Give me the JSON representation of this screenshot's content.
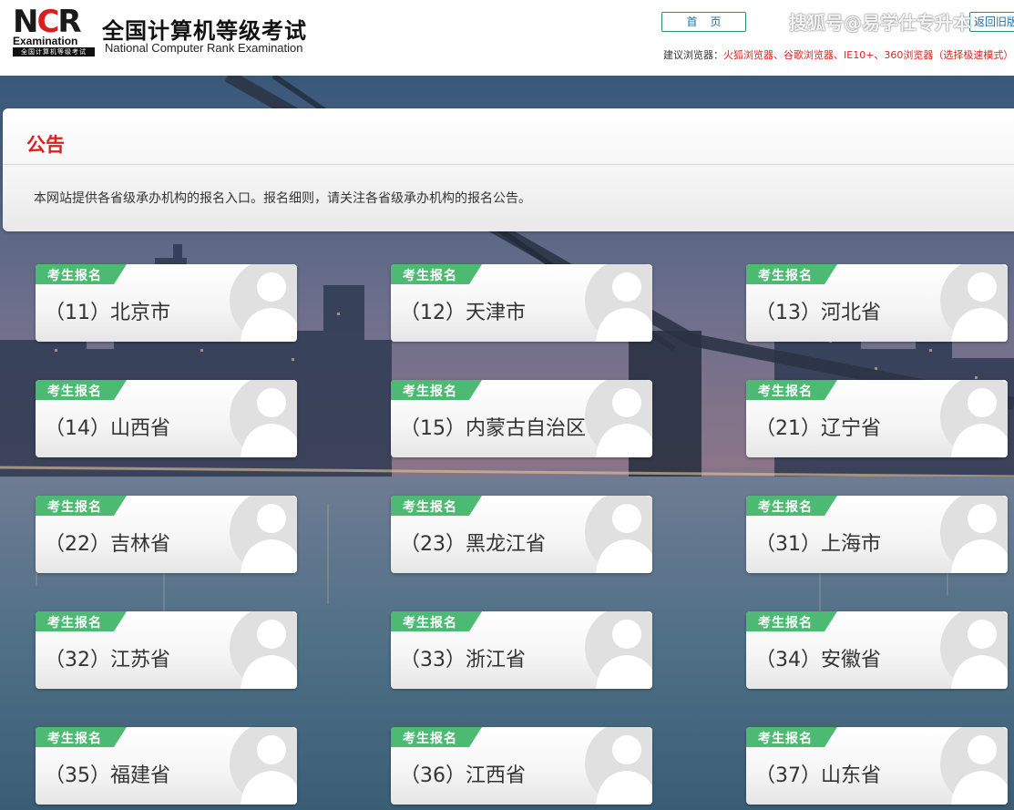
{
  "header": {
    "logo_letters_a": "N",
    "logo_letters_b": "C",
    "logo_letters_c": "R",
    "logo_exam": "Examination",
    "logo_bar": "全国计算机等级考试",
    "title": "全国计算机等级考试",
    "subtitle": "National Computer Rank Examination",
    "home_label": "首页",
    "back_label": "返回旧版",
    "watermark": "搜狐号@易学仕专升本",
    "browser_note_prefix": "建议浏览器：",
    "browser_note_list": "火狐浏览器、谷歌浏览器、IE10+、360浏览器（选择极速模式）"
  },
  "notice": {
    "title": "公告",
    "text": "本网站提供各省级承办机构的报名入口。报名细则，请关注各省级承办机构的报名公告。"
  },
  "card_tag": "考生报名",
  "provinces": [
    "（11）北京市",
    "（12）天津市",
    "（13）河北省",
    "（14）山西省",
    "（15）内蒙古自治区",
    "（21）辽宁省",
    "（22）吉林省",
    "（23）黑龙江省",
    "（31）上海市",
    "（32）江苏省",
    "（33）浙江省",
    "（34）安徽省",
    "（35）福建省",
    "（36）江西省",
    "（37）山东省"
  ],
  "colors": {
    "accent_red": "#e0201e",
    "tag_green": "#4cba72",
    "link_blue": "#1d6fa8"
  }
}
